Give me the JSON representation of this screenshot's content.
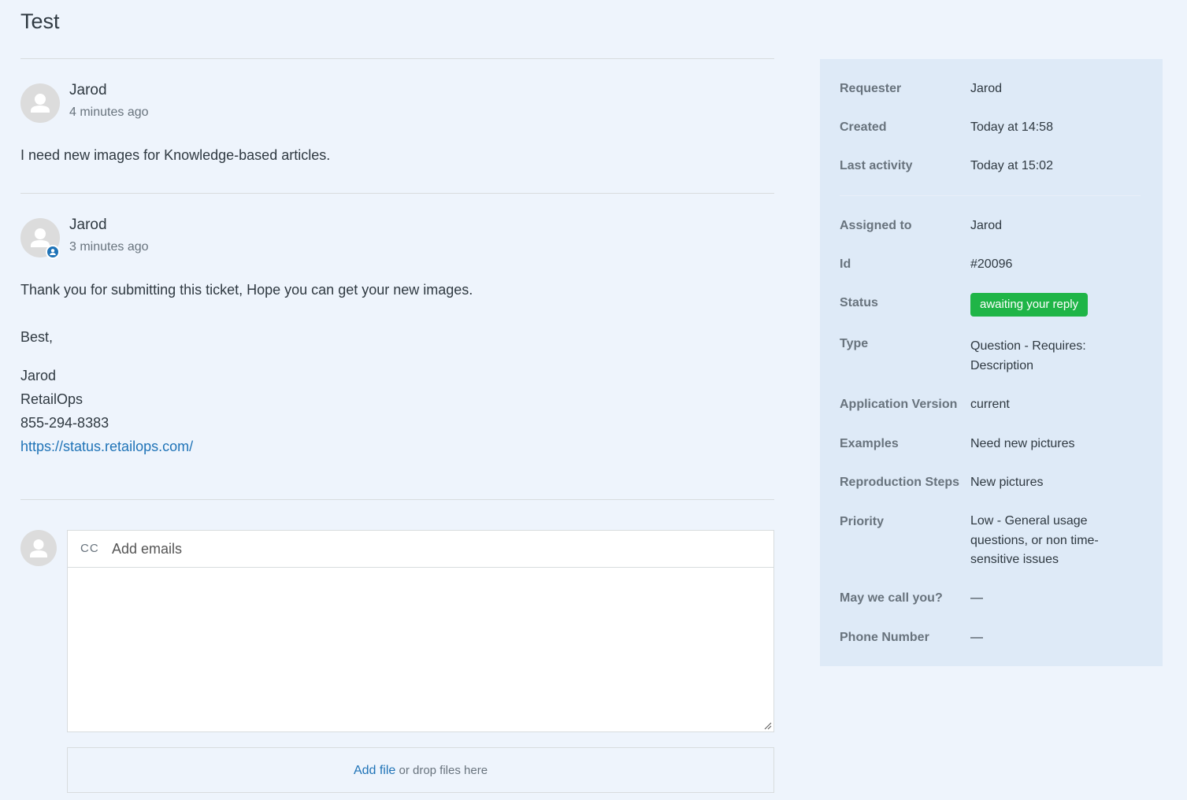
{
  "page": {
    "title": "Test"
  },
  "comments": [
    {
      "author": "Jarod",
      "time": "4 minutes ago",
      "body": [
        "I need new images for Knowledge-based articles."
      ],
      "agent": false
    },
    {
      "author": "Jarod",
      "time": "3 minutes ago",
      "body": [
        "Thank you for submitting this ticket, Hope you can get your new images.",
        "Best,",
        "Jarod",
        "RetailOps",
        "855-294-8383"
      ],
      "link": "https://status.retailops.com/",
      "agent": true
    }
  ],
  "reply": {
    "cc_label": "CC",
    "cc_placeholder": "Add emails",
    "add_file": "Add file",
    "drop_text": "or drop files here"
  },
  "sidebar": {
    "requester": {
      "label": "Requester",
      "value": "Jarod"
    },
    "created": {
      "label": "Created",
      "value": "Today at 14:58"
    },
    "last_activity": {
      "label": "Last activity",
      "value": "Today at 15:02"
    },
    "assigned_to": {
      "label": "Assigned to",
      "value": "Jarod"
    },
    "id": {
      "label": "Id",
      "value": "#20096"
    },
    "status": {
      "label": "Status",
      "value": "awaiting your reply"
    },
    "type": {
      "label": "Type",
      "value": "Question - Requires: Description"
    },
    "app_version": {
      "label": "Application Version",
      "value": "current"
    },
    "examples": {
      "label": "Examples",
      "value": "Need new pictures"
    },
    "repro_steps": {
      "label": "Reproduction Steps",
      "value": "New pictures"
    },
    "priority": {
      "label": "Priority",
      "value": "Low - General usage questions, or non time-sensitive issues"
    },
    "may_call": {
      "label": "May we call you?",
      "value": "—"
    },
    "phone": {
      "label": "Phone Number",
      "value": "—"
    }
  },
  "colors": {
    "status_green": "#1fb547",
    "link_blue": "#1f73b7",
    "sidebar_bg": "#deeaf7",
    "page_bg": "#eef4fc"
  },
  "icons": [
    "user-avatar-icon",
    "agent-badge-icon",
    "resize-handle-icon"
  ]
}
